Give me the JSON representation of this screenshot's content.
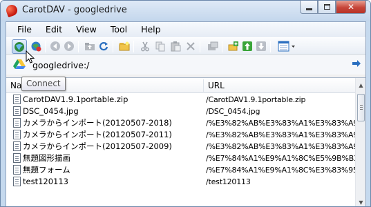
{
  "window": {
    "title": "CarotDAV - googledrive",
    "buttons": [
      "minimize",
      "maximize",
      "close"
    ]
  },
  "menubar": {
    "items": [
      "File",
      "Edit",
      "View",
      "Tool",
      "Help"
    ]
  },
  "toolbar": {
    "buttons": [
      "connect-icon",
      "disconnect-icon",
      "back-icon",
      "forward-icon",
      "up-folder-icon",
      "refresh-icon",
      "new-folder-icon",
      "cut-icon",
      "copy-icon",
      "paste-icon",
      "delete-icon",
      "properties-icon",
      "add-favorite-icon",
      "upload-icon",
      "download-icon",
      "view-mode-icon"
    ]
  },
  "address": {
    "value": "googledrive:/"
  },
  "tooltip": {
    "text": "Connect"
  },
  "filelist": {
    "columns": [
      "Na",
      "URL"
    ],
    "rows": [
      {
        "name": "CarotDAV1.9.1portable.zip",
        "url": "/CarotDAV1.9.1portable.zip"
      },
      {
        "name": "DSC_0454.jpg",
        "url": "/DSC_0454.jpg"
      },
      {
        "name": "カメラからインポート(20120507-2018)",
        "url": "/%E3%82%AB%E3%83%A1%E3%83%A9%E3%8"
      },
      {
        "name": "カメラからインポート(20120507-2011)",
        "url": "/%E3%82%AB%E3%83%A1%E3%83%A9%E3%8"
      },
      {
        "name": "カメラからインポート(20120507-2009)",
        "url": "/%E3%82%AB%E3%83%A1%E3%83%A9%E3%8"
      },
      {
        "name": "無題図形描画",
        "url": "/%E7%84%A1%E9%A1%8C%E5%9B%B3%E5%BD"
      },
      {
        "name": "無題フォーム",
        "url": "/%E7%84%A1%E9%A1%8C%E3%83%95%E3%82"
      },
      {
        "name": "test120113",
        "url": "/test120113"
      }
    ]
  },
  "colors": {
    "titlebar": "#c5d9ee",
    "close_button": "#c7463a",
    "toolbar_pressed": "#bcd3f0"
  }
}
